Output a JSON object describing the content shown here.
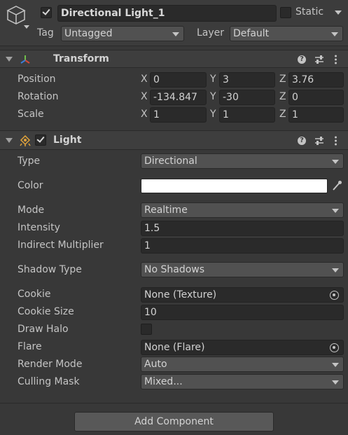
{
  "header": {
    "name": "Directional Light_1",
    "active": true,
    "static_label": "Static",
    "static_checked": false,
    "tag_label": "Tag",
    "tag_value": "Untagged",
    "layer_label": "Layer",
    "layer_value": "Default"
  },
  "transform": {
    "title": "Transform",
    "position": {
      "label": "Position",
      "x": "0",
      "y": "3",
      "z": "3.76"
    },
    "rotation": {
      "label": "Rotation",
      "x": "-134.847",
      "y": "-30",
      "z": "0"
    },
    "scale": {
      "label": "Scale",
      "x": "1",
      "y": "1",
      "z": "1"
    },
    "axis_x": "X",
    "axis_y": "Y",
    "axis_z": "Z"
  },
  "light": {
    "title": "Light",
    "enabled": true,
    "type": {
      "label": "Type",
      "value": "Directional"
    },
    "color": {
      "label": "Color",
      "value": "#ffffff"
    },
    "mode": {
      "label": "Mode",
      "value": "Realtime"
    },
    "intensity": {
      "label": "Intensity",
      "value": "1.5"
    },
    "indirect": {
      "label": "Indirect Multiplier",
      "value": "1"
    },
    "shadow": {
      "label": "Shadow Type",
      "value": "No Shadows"
    },
    "cookie": {
      "label": "Cookie",
      "value": "None (Texture)"
    },
    "cookie_size": {
      "label": "Cookie Size",
      "value": "10"
    },
    "draw_halo": {
      "label": "Draw Halo",
      "checked": false
    },
    "flare": {
      "label": "Flare",
      "value": "None (Flare)"
    },
    "render_mode": {
      "label": "Render Mode",
      "value": "Auto"
    },
    "culling": {
      "label": "Culling Mask",
      "value": "Mixed..."
    }
  },
  "add_component_label": "Add Component",
  "help_glyph": "?"
}
